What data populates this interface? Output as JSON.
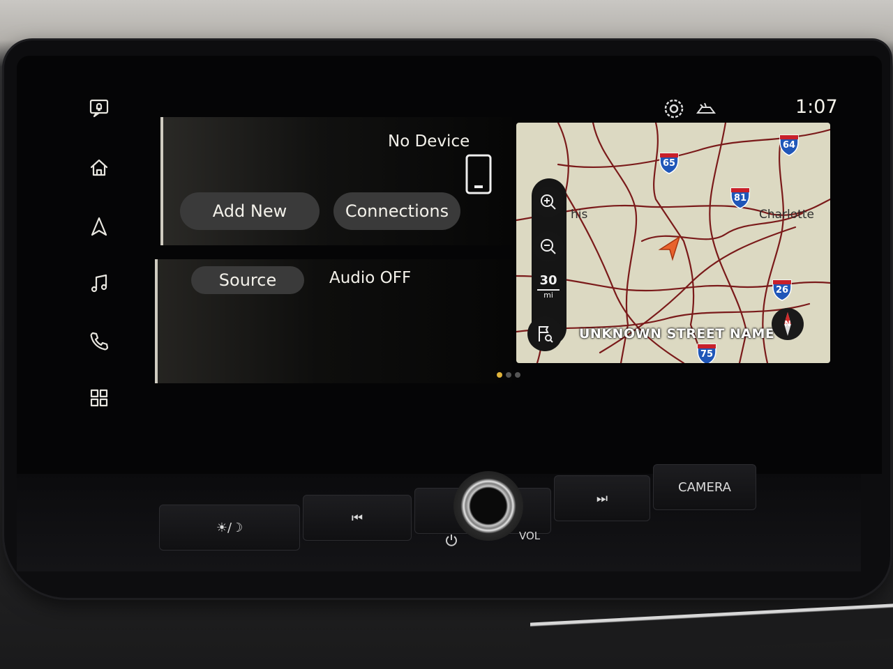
{
  "status": {
    "clock": "1:07",
    "icons": [
      "settings-gear-icon",
      "vehicle-status-icon"
    ]
  },
  "sidebar": {
    "items": [
      {
        "name": "notification-icon"
      },
      {
        "name": "home-icon"
      },
      {
        "name": "navigation-icon"
      },
      {
        "name": "music-icon"
      },
      {
        "name": "phone-icon"
      },
      {
        "name": "apps-grid-icon"
      }
    ]
  },
  "phone_panel": {
    "status_text": "No Device",
    "add_new_label": "Add New",
    "connections_label": "Connections"
  },
  "audio_panel": {
    "source_label": "Source",
    "status_text": "Audio OFF"
  },
  "map": {
    "street_name": "UNKNOWN STREET NAME",
    "scale_value": "30",
    "scale_unit": "mi",
    "cities": {
      "left": "his",
      "right": "Charlotte"
    },
    "interstates": [
      "65",
      "64",
      "81",
      "26",
      "75"
    ],
    "compass_label": "N"
  },
  "pager": {
    "count": 3,
    "active": 0
  },
  "hardware": {
    "day_night_label": "☀/☽",
    "prev_label": "⏮",
    "next_label": "⏭",
    "camera_label": "CAMERA",
    "vol_label": "VOL"
  },
  "colors": {
    "accent": "#e0b33b",
    "pill_bg": "#3a3a3a",
    "map_bg": "#dcd9c2",
    "road": "#7a1a1a"
  }
}
